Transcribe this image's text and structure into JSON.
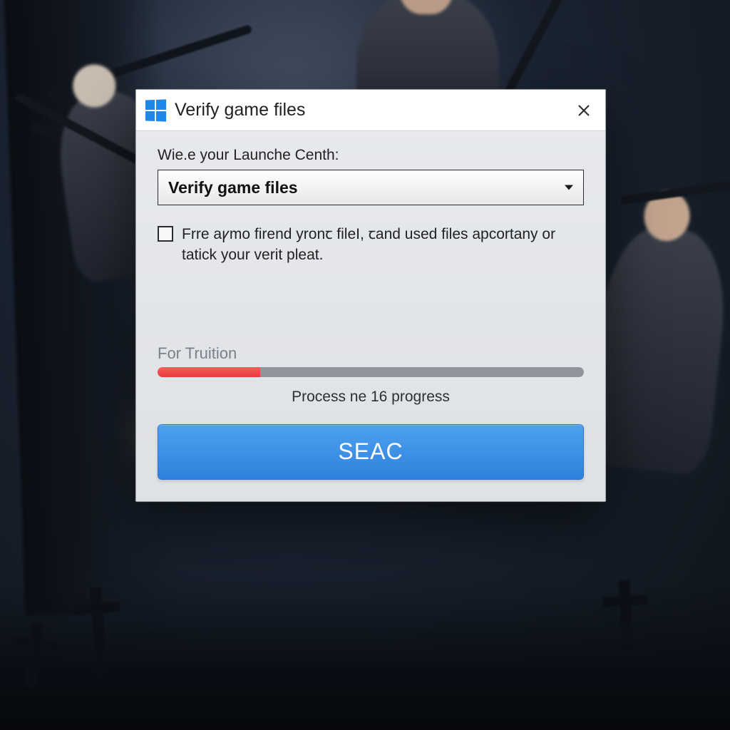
{
  "dialog": {
    "title": "Verify game files",
    "field_label": "Wie.e your Launche Centh:",
    "select_value": "Verify game files",
    "checkbox_text": "Frre aꝩmo firend yronꞇ fileI, ꞇand used files apcortany or tatick your verit pleat.",
    "checkbox_checked": false,
    "progress": {
      "label": "For Truition",
      "percent": 24,
      "fill_color": "#e23c3c",
      "status_text": "Process ne 16 progress"
    },
    "primary_button": "SEAC"
  },
  "colors": {
    "accent": "#2f82dc",
    "progress_fill": "#e23c3c",
    "dialog_bg": "#e3e5e8"
  }
}
